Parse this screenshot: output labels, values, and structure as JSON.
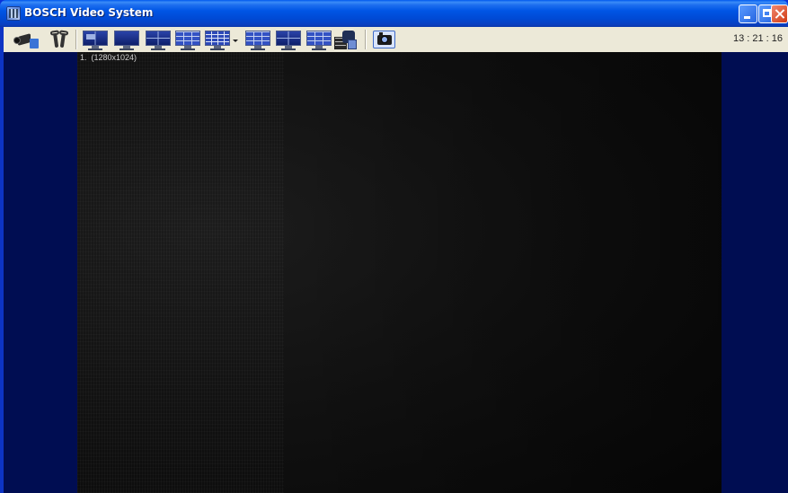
{
  "window": {
    "title": "BOSCH Video System",
    "icon": "bosch-app-icon",
    "controls": [
      "minimize-icon",
      "maximize-icon",
      "close-icon"
    ]
  },
  "toolbar": {
    "buttons": [
      {
        "name": "camera-config-icon"
      },
      {
        "name": "tools-icon"
      },
      {
        "name": "layout-dual-pip-icon"
      },
      {
        "name": "layout-single-icon"
      },
      {
        "name": "layout-quad-icon"
      },
      {
        "name": "layout-9-icon"
      },
      {
        "name": "layout-16-icon"
      },
      {
        "name": "layout-dropdown-icon"
      },
      {
        "name": "layout-split-icon"
      },
      {
        "name": "layout-quad-2-icon"
      },
      {
        "name": "layout-9-2-icon"
      },
      {
        "name": "playback-archive-icon"
      },
      {
        "name": "snapshot-icon"
      }
    ],
    "clock": "13 : 21 : 16"
  },
  "video": {
    "overlay_label": "1.  (1280x1024)"
  },
  "colors": {
    "titlebar": "#0055e5",
    "toolbar": "#ece9d8",
    "workspace": "#000d52",
    "video": "#111111"
  }
}
